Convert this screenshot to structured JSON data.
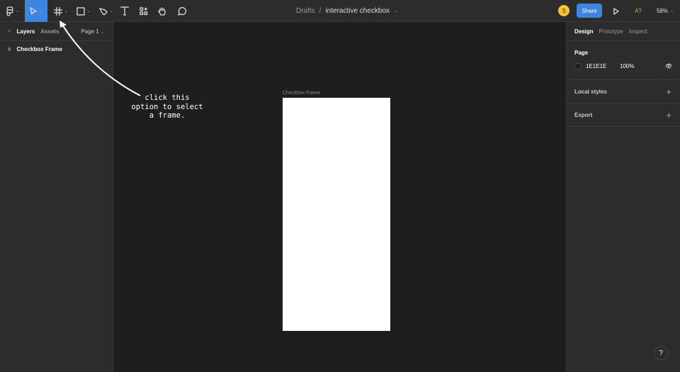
{
  "toolbar": {
    "breadcrumb_parent": "Drafts",
    "breadcrumb_sep": "/",
    "file_name": "interactive checkbox",
    "avatar_initial": "S",
    "share_label": "Share",
    "font_warning": "A?",
    "zoom": "58%",
    "accent": "#3d85e0"
  },
  "left_panel": {
    "tabs": [
      "Layers",
      "Assets"
    ],
    "page": "Page 1",
    "layers": [
      {
        "name": "Checkbox Frame",
        "icon": "frame-icon"
      }
    ]
  },
  "canvas": {
    "frame_label": "Checkbox Frame",
    "annotation": [
      "click this",
      "option to select",
      "a frame."
    ],
    "background": "#1E1E1E"
  },
  "right_panel": {
    "tabs": [
      "Design",
      "Prototype",
      "Inspect"
    ],
    "page_heading": "Page",
    "page_color": "1E1E1E",
    "page_opacity": "100%",
    "local_styles": "Local styles",
    "export": "Export"
  },
  "help": "?"
}
